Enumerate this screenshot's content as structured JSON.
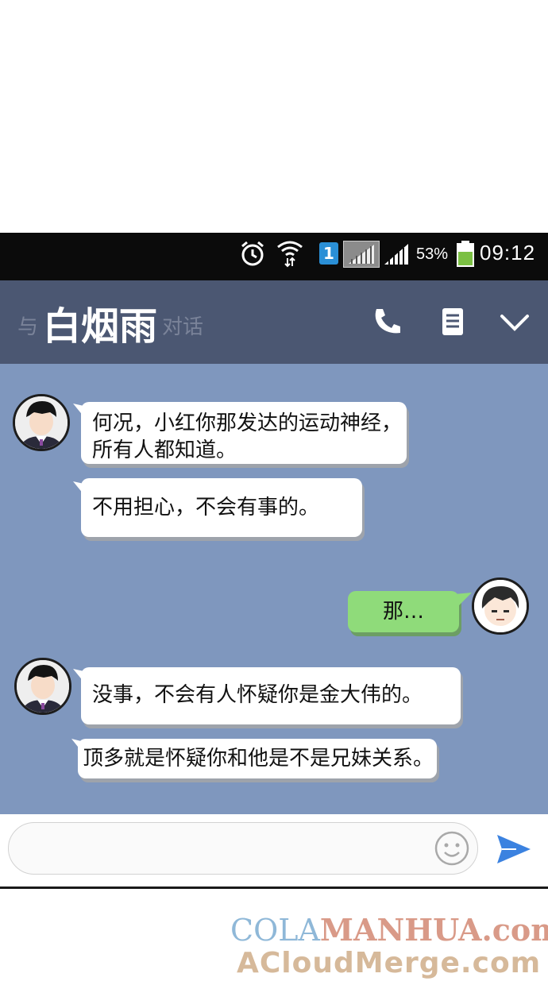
{
  "status_bar": {
    "sim_slot": "1",
    "battery": "53%",
    "time": "09:12"
  },
  "header": {
    "prefix": "与",
    "contact_name": "白烟雨",
    "suffix": "对话"
  },
  "messages": [
    {
      "side": "left",
      "lines": [
        "何况，小红你那发达的运动神经，",
        "所有人都知道。"
      ]
    },
    {
      "side": "left",
      "lines": [
        "不用担心，不会有事的。"
      ]
    },
    {
      "side": "right",
      "lines": [
        "那…"
      ]
    },
    {
      "side": "left",
      "lines": [
        "没事，不会有人怀疑你是金大伟的。"
      ]
    },
    {
      "side": "left",
      "lines": [
        "顶多就是怀疑你和他是不是兄妹关系。"
      ]
    }
  ],
  "watermark": {
    "line1_part1": "COLA",
    "line1_part2": "MANHUA.com",
    "line2": "ACloudMerge.com"
  },
  "colors": {
    "status_bar": "#0b0b0b",
    "header": "#4b5772",
    "chat_background": "#7f97be",
    "outgoing_bubble": "#8fdb7a",
    "incoming_bubble": "#ffffff",
    "send_icon": "#3b82e0"
  }
}
